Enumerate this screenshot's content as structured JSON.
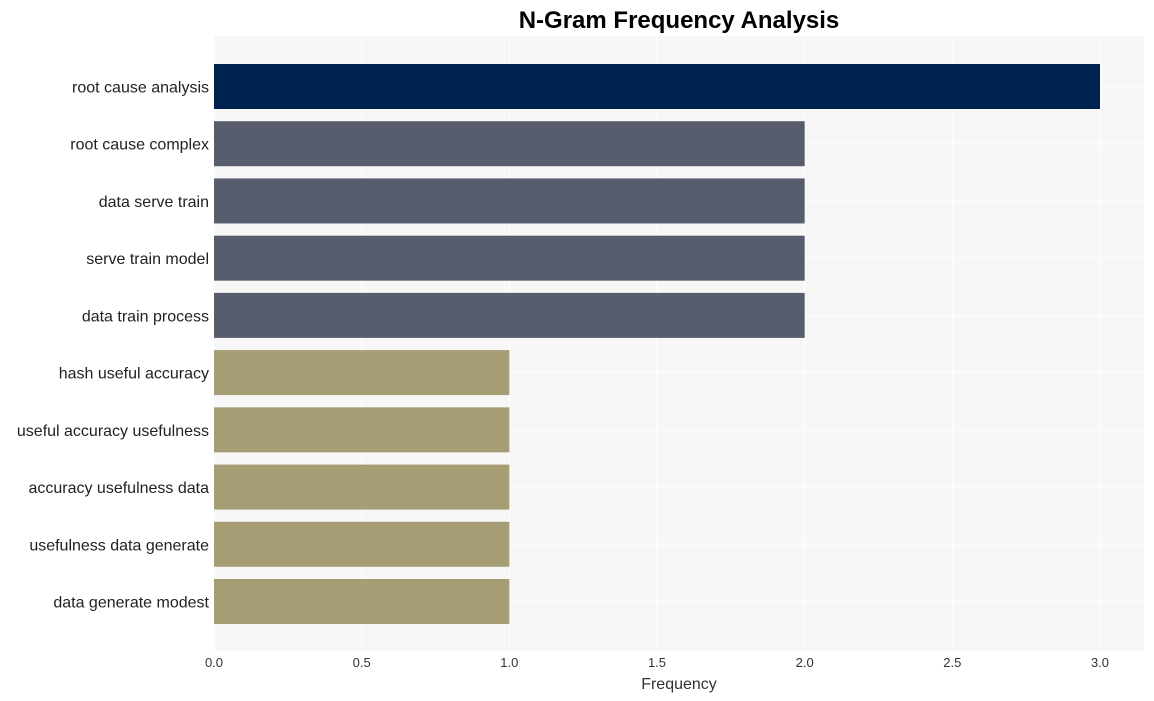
{
  "chart_data": {
    "type": "bar",
    "orientation": "horizontal",
    "title": "N-Gram Frequency Analysis",
    "xlabel": "Frequency",
    "ylabel": "",
    "xlim": [
      0,
      3.15
    ],
    "xticks": [
      0.0,
      0.5,
      1.0,
      1.5,
      2.0,
      2.5,
      3.0
    ],
    "xtick_labels": [
      "0.0",
      "0.5",
      "1.0",
      "1.5",
      "2.0",
      "2.5",
      "3.0"
    ],
    "grid": true,
    "legend": "none",
    "categories": [
      "root cause analysis",
      "root cause complex",
      "data serve train",
      "serve train model",
      "data train process",
      "hash useful accuracy",
      "useful accuracy usefulness",
      "accuracy usefulness data",
      "usefulness data generate",
      "data generate modest"
    ],
    "values": [
      3,
      2,
      2,
      2,
      2,
      1,
      1,
      1,
      1,
      1
    ],
    "colors": {
      "3": "#00224e",
      "2": "#575d6d",
      "1": "#a69d75"
    },
    "background": "#f7f7f7",
    "gridline_color": "#ffffff"
  }
}
